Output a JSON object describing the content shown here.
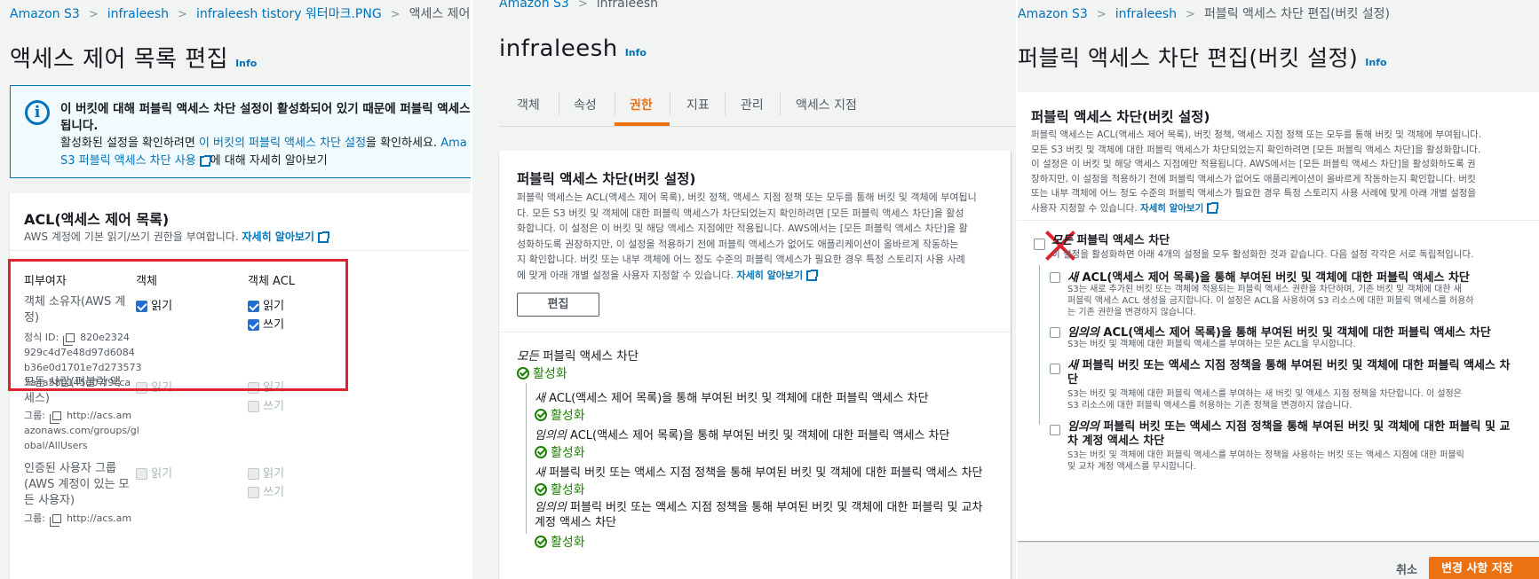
{
  "panel1": {
    "breadcrumb": [
      "Amazon S3",
      "infraleesh",
      "infraleesh tistory 워터마크.PNG",
      "액세스 제어 목록 편집"
    ],
    "title": "액세스 제어 목록 편집",
    "info_label": "Info",
    "alert": {
      "line1": "이 버킷에 대해 퍼블릭 액세스 차단 설정이 활성화되어 있기 때문에 퍼블릭 액세스가",
      "line1b": "됩니다.",
      "line2_pre": "활성화된 설정을 확인하려면",
      "line2_link": "이 버킷의 퍼블릭 액세스 차단 설정",
      "line2_post": "을 확인하세요.",
      "line2_tail": "Ama",
      "line3_link": "S3 퍼블릭 액세스 차단 사용",
      "line3_post": "에 대해 자세히 알아보기"
    },
    "acl": {
      "title": "ACL(액세스 제어 목록)",
      "desc": "AWS 계정에 기본 읽기/쓰기 권한을 부여합니다.",
      "learn_more": "자세히 알아보기",
      "col_grantee": "피부여자",
      "col_object": "객체",
      "col_object_acl": "객체 ACL",
      "rows": [
        {
          "grantee_l1": "객체 소유자(AWS 계",
          "grantee_l2": "정)",
          "id_label": "정식 ID:",
          "id_l1": "820e2324",
          "id_l2": "929c4d7e48d97d6084",
          "id_l3": "b36e0d1701e7d273573",
          "id_l4": "7a4a580145d07f9cca",
          "object_read": "읽기",
          "acl_read": "읽기",
          "acl_write": "쓰기"
        },
        {
          "grantee_l1": "모든 사람(퍼블릭 액",
          "grantee_l2": "세스)",
          "group_label": "그룹:",
          "group_l1": "http://acs.am",
          "group_l2": "azonaws.com/groups/gl",
          "group_l3": "obal/AllUsers",
          "object_read": "읽기",
          "acl_read": "읽기",
          "acl_write": "쓰기"
        },
        {
          "grantee_l1": "인증된 사용자 그룹",
          "grantee_l2": "(AWS 계정이 있는 모",
          "grantee_l3": "든 사용자)",
          "group_label": "그룹:",
          "group_l1": "http://acs.am",
          "object_read": "읽기",
          "acl_read": "읽기",
          "acl_write": "쓰기"
        }
      ]
    }
  },
  "panel2": {
    "breadcrumb": [
      "Amazon S3",
      "infraleesh"
    ],
    "title": "infraleesh",
    "info_label": "Info",
    "tabs": [
      "객체",
      "속성",
      "권한",
      "지표",
      "관리",
      "액세스 지점"
    ],
    "active_tab": "권한",
    "section_title": "퍼블릭 액세스 차단(버킷 설정)",
    "desc": [
      "퍼블릭 액세스는 ACL(액세스 제어 목록), 버킷 정책, 액세스 지점 정책 또는 모두를 통해 버킷 및 객체에 부여됩니",
      "다. 모든 S3 버킷 및 객체에 대한 퍼블릭 액세스가 차단되었는지 확인하려면 [모든 퍼블릭 액세스 차단]을 활성",
      "화합니다. 이 설정은 이 버킷 및 해당 액세스 지점에만 적용됩니다. AWS에서는 [모든 퍼블릭 액세스 차단]을 활",
      "성화하도록 권장하지만, 이 설정을 적용하기 전에 퍼블릭 액세스가 없어도 애플리케이션이 올바르게 작동하는",
      "지 확인합니다. 버킷 또는 내부 객체에 어느 정도 수준의 퍼블릭 액세스가 필요한 경우 특정 스토리지 사용 사례",
      "에 맞게 아래 개별 설정을 사용자 지정할 수 있습니다."
    ],
    "learn_more": "자세히 알아보기",
    "edit_button": "편집",
    "all_block": {
      "em": "모든",
      "rest": " 퍼블릭 액세스 차단",
      "status": "활성화"
    },
    "items": [
      {
        "em": "새",
        "rest": " ACL(액세스 제어 목록)을 통해 부여된 버킷 및 객체에 대한 퍼블릭 액세스 차단",
        "status": "활성화"
      },
      {
        "em": "임의의",
        "rest": " ACL(액세스 제어 목록)을 통해 부여된 버킷 및 객체에 대한 퍼블릭 액세스 차단",
        "status": "활성화"
      },
      {
        "em": "새",
        "rest": " 퍼블릭 버킷 또는 액세스 지점 정책을 통해 부여된 버킷 및 객체에 대한 퍼블릭 액세스 차단",
        "status": "활성화"
      },
      {
        "em": "임의의",
        "rest": " 퍼블릭 버킷 또는 액세스 지점 정책을 통해 부여된 버킷 및 객체에 대한 퍼블릭 및 교차",
        "rest2": "계정 액세스 차단",
        "status": "활성화"
      }
    ]
  },
  "panel3": {
    "breadcrumb": [
      "Amazon S3",
      "infraleesh",
      "퍼블릭 액세스 차단 편집(버킷 설정)"
    ],
    "title": "퍼블릭 액세스 차단 편집(버킷 설정)",
    "info_label": "Info",
    "section_title": "퍼블릭 액세스 차단(버킷 설정)",
    "desc": [
      "퍼블릭 액세스는 ACL(액세스 제어 목록), 버킷 정책, 액세스 지점 정책 또는 모두를 통해 버킷 및 객체에 부여됩니다.",
      "모든 S3 버킷 및 객체에 대한 퍼블릭 액세스가 차단되었는지 확인하려면 [모든 퍼블릭 액세스 차단]을 활성화합니다.",
      "이 설정은 이 버킷 및 해당 액세스 지점에만 적용됩니다. AWS에서는 [모든 퍼블릭 액세스 차단]을 활성화하도록 권",
      "장하지만, 이 설정을 적용하기 전에 퍼블릭 액세스가 없어도 애플리케이션이 올바르게 작동하는지 확인합니다. 버킷",
      "또는 내부 객체에 어느 정도 수준의 퍼블릭 액세스가 필요한 경우 특정 스토리지 사용 사례에 맞게 아래 개별 설정을",
      "사용자 지정할 수 있습니다."
    ],
    "learn_more": "자세히 알아보기",
    "all_block": {
      "em": "모든",
      "rest": " 퍼블릭 액세스 차단",
      "desc": "이 설정을 활성화하면 아래 4개의 설정을 모두 활성화한 것과 같습니다. 다음 설정 각각은 서로 독립적입니다."
    },
    "items": [
      {
        "em": "새",
        "rest": " ACL(액세스 제어 목록)을 통해 부여된 버킷 및 객체에 대한 퍼블릭 액세스 차단",
        "desc": [
          "S3는 새로 추가된 버킷 또는 객체에 적용되는 퍼블릭 액세스 권한을 차단하며, 기존 버킷 및 객체에 대한 새",
          "퍼블릭 액세스 ACL 생성을 금지합니다. 이 설정은 ACL을 사용하여 S3 리소스에 대한 퍼블릭 액세스를 허용하",
          "는 기존 권한을 변경하지 않습니다."
        ]
      },
      {
        "em": "임의의",
        "rest": " ACL(액세스 제어 목록)을 통해 부여된 버킷 및 객체에 대한 퍼블릭 액세스 차단",
        "desc": [
          "S3는 버킷 및 객체에 대한 퍼블릭 액세스를 부여하는 모든 ACL을 무시합니다."
        ]
      },
      {
        "em": "새",
        "rest": " 퍼블릭 버킷 또는 액세스 지점 정책을 통해 부여된 버킷 및 객체에 대한 퍼블릭 액세스 차",
        "rest2": "단",
        "desc": [
          "S3는 버킷 및 객체에 대한 퍼블릭 액세스를 부여하는 새 버킷 및 액세스 지점 정책을 차단합니다. 이 설정은",
          "S3 리소스에 대한 퍼블릭 액세스를 허용하는 기존 정책을 변경하지 않습니다."
        ]
      },
      {
        "em": "임의의",
        "rest": " 퍼블릭 버킷 또는 액세스 지점 정책을 통해 부여된 버킷 및 객체에 대한 퍼블릭 및 교",
        "rest2": "차 계정 액세스 차단",
        "desc": [
          "S3는 버킷 및 객체에 대한 퍼블릭 액세스를 부여하는 정책을 사용하는 버킷 또는 액세스 지점에 대한 퍼블릭",
          "및 교차 계정 액세스를 무시합니다."
        ]
      }
    ],
    "cancel_button": "취소",
    "save_button": "변경 사항 저장"
  },
  "colors": {
    "link": "#0073bb",
    "active_tab": "#ec7211",
    "success": "#1d8102",
    "highlight_box": "#e0232e",
    "primary_button": "#ec7211",
    "cross_mark": "#e0232e"
  }
}
